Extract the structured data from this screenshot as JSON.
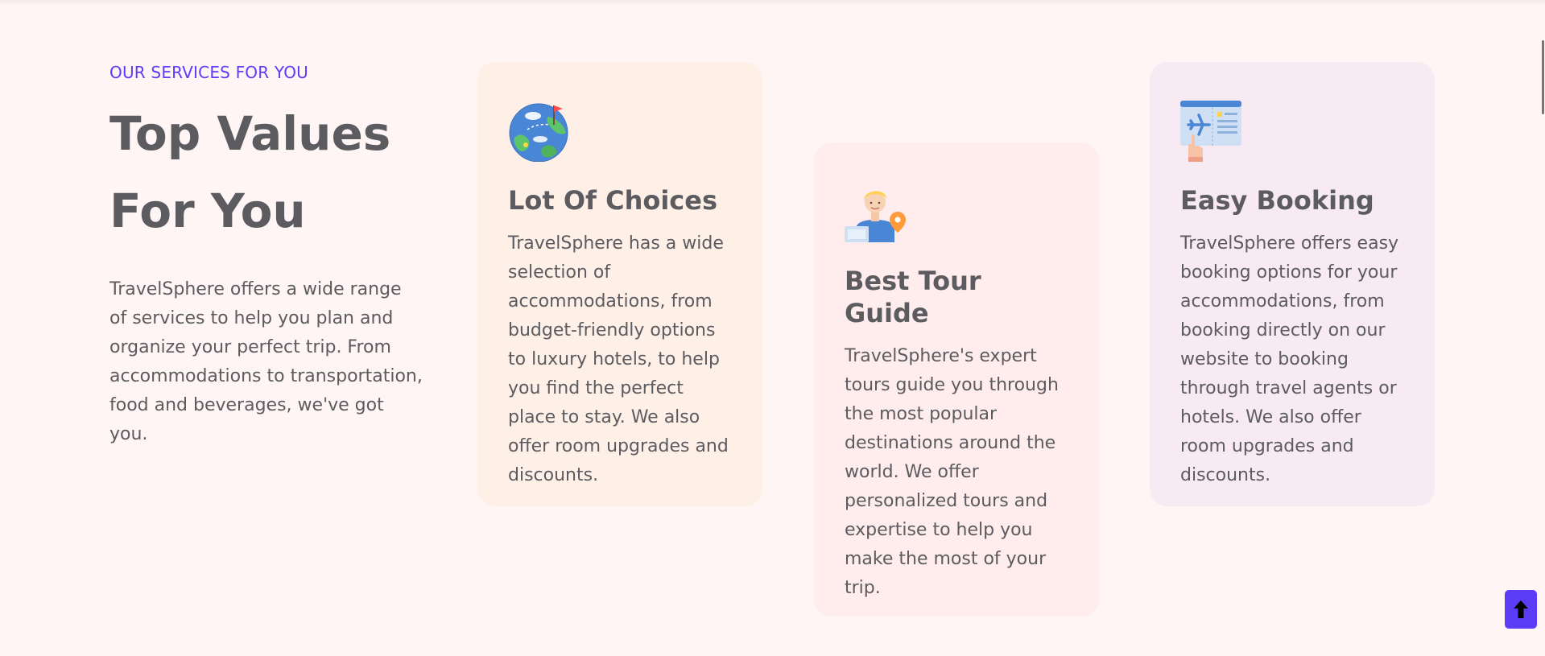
{
  "intro": {
    "eyebrow": "OUR SERVICES FOR YOU",
    "headline_line1": "Top Values",
    "headline_line2": "For You",
    "description": "TravelSphere offers a wide range of services to help you plan and organize your perfect trip. From accommodations to transportation, food and beverages, we've got you."
  },
  "cards": [
    {
      "icon": "globe-icon",
      "title": "Lot Of Choices",
      "text": "TravelSphere has a wide selection of accommodations, from budget-friendly options to luxury hotels, to help you find the perfect place to stay. We also offer room upgrades and discounts.",
      "background": "#fff0e7"
    },
    {
      "icon": "tour-guide-icon",
      "title": "Best Tour Guide",
      "text": "TravelSphere's expert tours guide you through the most popular destinations around the world. We offer personalized tours and expertise to help you make the most of your trip.",
      "background": "#ffecec"
    },
    {
      "icon": "flight-ticket-icon",
      "title": "Easy Booking",
      "text": "TravelSphere offers easy booking options for your accommodations, from booking directly on our website to booking through travel agents or hotels. We also offer room upgrades and discounts.",
      "background": "#f7eaf3"
    }
  ],
  "scroll_top_button": {
    "icon": "arrow-up-icon"
  },
  "colors": {
    "accent": "#5b3df5",
    "text": "#5b5b60",
    "page_background": "#fff5f4"
  }
}
